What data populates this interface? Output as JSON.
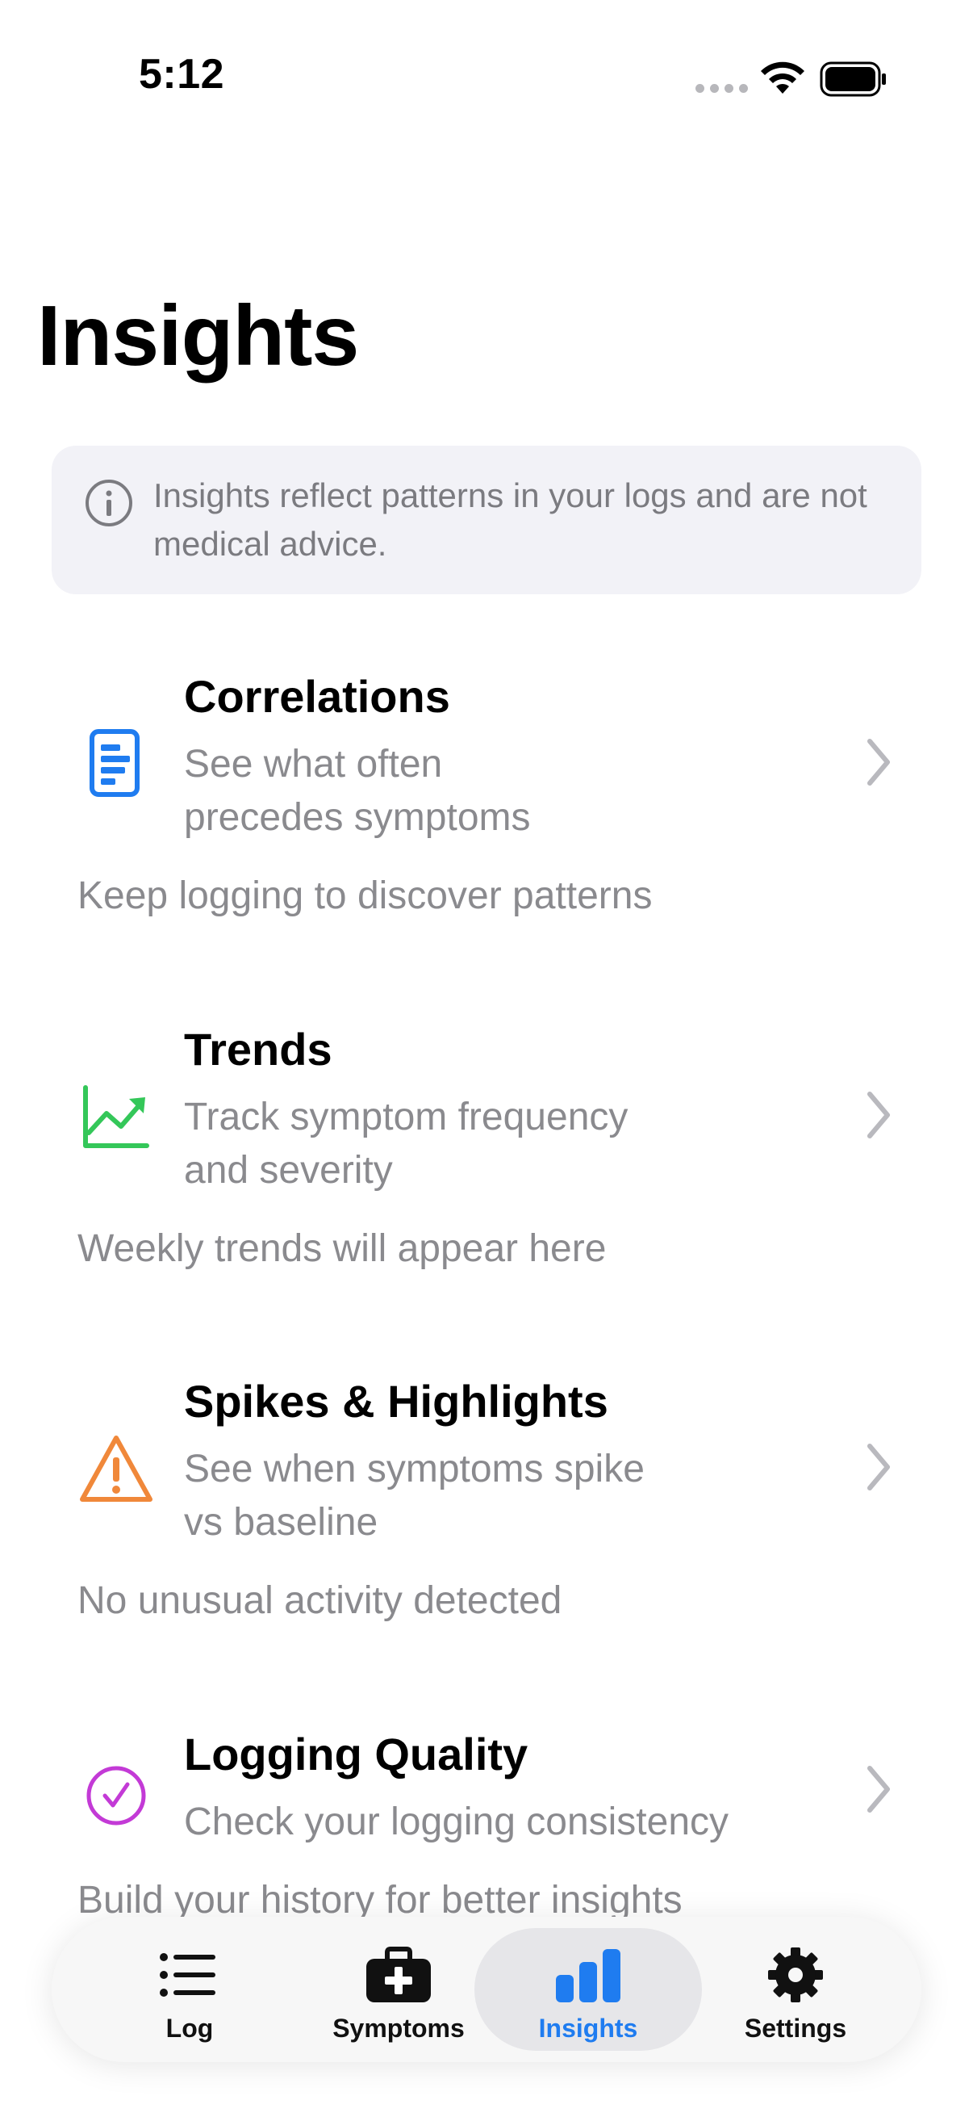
{
  "status_bar": {
    "time": "5:12"
  },
  "page_title": "Insights",
  "notice": {
    "icon": "info-icon",
    "text": "Insights reflect patterns in your logs and are not medical advice."
  },
  "cards": [
    {
      "title": "Correlations",
      "subtitle_line1": "See what often",
      "subtitle_line2": "precedes symptoms",
      "note": "Keep logging to discover patterns",
      "icon": "document-chart-icon",
      "color": "#1f7cf0"
    },
    {
      "title": "Trends",
      "subtitle_line1": "Track symptom frequency",
      "subtitle_line2": "and severity",
      "note": "Weekly trends will appear here",
      "icon": "trend-up-icon",
      "color": "#34c759"
    },
    {
      "title": "Spikes & Highlights",
      "subtitle_line1": "See when symptoms spike",
      "subtitle_line2": "vs baseline",
      "note": "No unusual activity detected",
      "icon": "warning-triangle-icon",
      "color": "#f0883a"
    },
    {
      "title": "Logging Quality",
      "subtitle_line1": "Check your logging consistency",
      "note": "Build your history for better insights",
      "icon": "checkmark-circle-icon",
      "color": "#c33ad6"
    }
  ],
  "tabs": [
    {
      "label": "Log",
      "icon": "list-icon",
      "active": false
    },
    {
      "label": "Symptoms",
      "icon": "medical-kit-icon",
      "active": false
    },
    {
      "label": "Insights",
      "icon": "bar-chart-icon",
      "active": true
    },
    {
      "label": "Settings",
      "icon": "gear-icon",
      "active": false
    }
  ],
  "colors": {
    "accent": "#1f7cf0",
    "secondary_text": "#8a8a8e",
    "notice_background": "#f2f2f7"
  }
}
